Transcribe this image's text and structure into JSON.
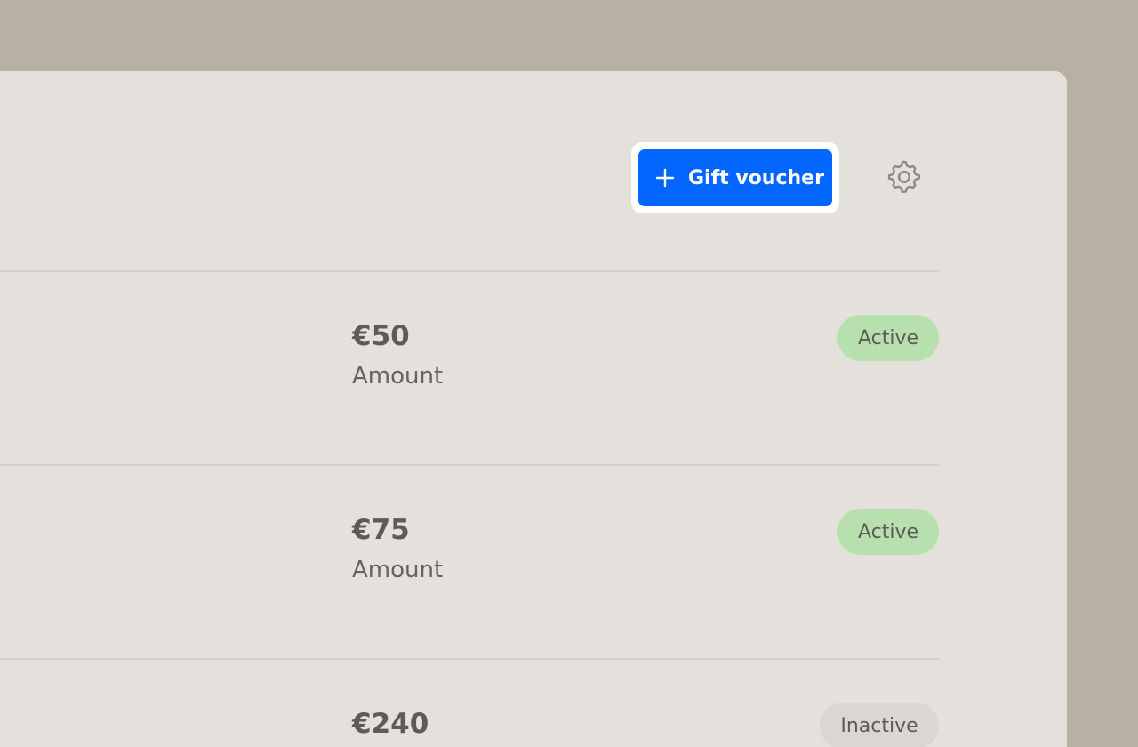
{
  "header": {
    "add_button_label": "Gift voucher",
    "add_icon": "plus-icon",
    "settings_icon": "gear-icon"
  },
  "vouchers": [
    {
      "amount": "€50",
      "amount_label": "Amount",
      "status": "Active"
    },
    {
      "amount": "€75",
      "amount_label": "Amount",
      "status": "Active"
    },
    {
      "amount": "€240",
      "amount_label": "Amount",
      "status": "Inactive"
    }
  ],
  "colors": {
    "primary": "#0366ff",
    "active_badge": "#b7e0ae",
    "inactive_badge": "#dad7d2",
    "panel_bg": "#e4e1dc",
    "page_bg": "#b8b0a3"
  }
}
